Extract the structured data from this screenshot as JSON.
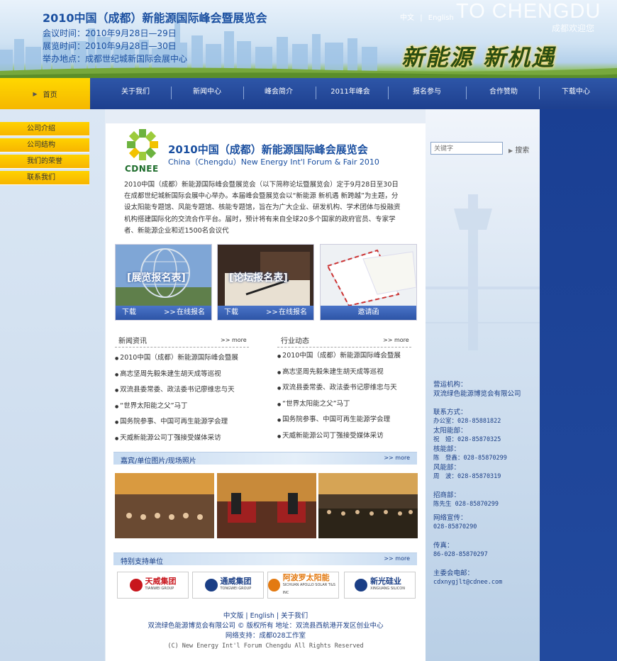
{
  "header": {
    "title": "2010中国（成都）新能源国际峰会暨展览会",
    "meeting_time": "会议时间：2010年9月28日—29日",
    "expo_time": "展览时间：2010年9月28日—30日",
    "venue": "举办地点：成都世纪城新国际会展中心",
    "lang_cn": "中文",
    "lang_sep": "|",
    "lang_en": "English",
    "to_chengdu": "TO CHENGDU",
    "welcome": "成都欢迎您",
    "slogan": "新能源 新机遇"
  },
  "nav": {
    "home": "首页",
    "items": [
      "关于我们",
      "新闻中心",
      "峰会简介",
      "2011年峰会",
      "报名参与",
      "合作赞助",
      "下载中心"
    ]
  },
  "left_menu": [
    "公司介绍",
    "公司结构",
    "我们的荣誉",
    "联系我们"
  ],
  "search": {
    "placeholder": "关键字",
    "button": "搜索"
  },
  "expo": {
    "logo_text": "CDNEE",
    "title": "2010中国（成都）新能源国际峰会展览会",
    "subtitle": "China（Chengdu）New Energy Int'l Forum & Fair 2010",
    "intro": "2010中国（成都）新能源国际峰会暨展览会（以下简称论坛暨展览会）定于9月28日至30日在成都世纪城新国际会展中心举办。本届峰会暨展览会以“新能源 新机遇 新跨越”为主题，分设太阳能专题馆、风能专题馆、核能专题馆，旨在为广大企业、研发机构、学术团体与投融资机构搭建国际化的交流合作平台。届时，预计将有来自全球20多个国家的政府官员、专家学者、新能源企业和近1500名会议代"
  },
  "cards": [
    {
      "label": "[展览报名表]",
      "left": "下载",
      "right": "在线报名"
    },
    {
      "label": "[论坛报名表]",
      "left": "下载",
      "right": "在线报名"
    },
    {
      "label": "",
      "center": "邀请函"
    }
  ],
  "news_section": {
    "title": "新闻资讯",
    "more": ">> more",
    "items": [
      "2010中国（成都）新能源国际峰会暨展",
      "高志坚周先毅朱建生胡天成等巡视",
      "双流县委常委、政法委书记廖维忠与天",
      "“世界太阳能之父”马丁",
      "国务院参事、中国可再生能源学会理",
      "天威新能源公司丁强接受媒体采访"
    ]
  },
  "industry_section": {
    "title": "行业动态",
    "more": ">> more",
    "items": [
      "2010中国（成都）新能源国际峰会暨展",
      "高志坚周先毅朱建生胡天成等巡视",
      "双流县委常委、政法委书记廖维忠与天",
      "“世界太阳能之父”马丁",
      "国务院参事、中国可再生能源学会理",
      "天威新能源公司丁强接受媒体采访"
    ]
  },
  "photos_band": {
    "title": "嘉宾/单位图片/现场照片",
    "more": ">> more"
  },
  "sponsors_band": {
    "title": "特别支持单位",
    "more": ">> more"
  },
  "sponsors": [
    {
      "cn": "天威集团",
      "en": "TIANWEI GROUP",
      "color": "#c8161d"
    },
    {
      "cn": "通威集团",
      "en": "TONGWEI GROUP",
      "color": "#1b3f86"
    },
    {
      "cn": "阿波罗太阳能",
      "en": "SICHUAN APOLLO SOLAR T&S INC",
      "color": "#e37a12"
    },
    {
      "cn": "新光硅业",
      "en": "XINGUANG SILICON",
      "color": "#1b3f86"
    }
  ],
  "contact": {
    "org_label": "营运机构：",
    "org": "双流绿色能源博览会有限公司",
    "method_label": "联系方式：",
    "office": "办公室：028-85881822",
    "solar_label": "太阳能部：",
    "solar": "祝　娅：028-85870325",
    "nuclear_label": "核能部：",
    "nuclear": "陈　登鑫：028-85870299",
    "wind_label": "风能部：",
    "wind": "周　波：028-85870319",
    "invest_label": "招商部：",
    "invest": "陈先生 028-85870299",
    "publicity_label": "网络宣传：",
    "publicity": "028-85870290",
    "fax_label": "传真：",
    "fax": "86-028-85870297",
    "email_label": "主委会电邮：",
    "email": "cdxnygjlt@cdnee.com"
  },
  "footer": {
    "links": "中文版 | English | 关于我们",
    "company": "双流绿色能源博览会有限公司 © 版权所有 地址：双流县西航港开发区创业中心",
    "support": "网络支持：成都028工作室",
    "copyright": "(C) New Energy Int'l Forum Chengdu All Rights Reserved"
  },
  "colors": {
    "nav_blue": "#2e56a8",
    "accent_yellow": "#ffd200",
    "title_blue": "#1a4fa0",
    "logo_green": "#1e6d2c"
  }
}
